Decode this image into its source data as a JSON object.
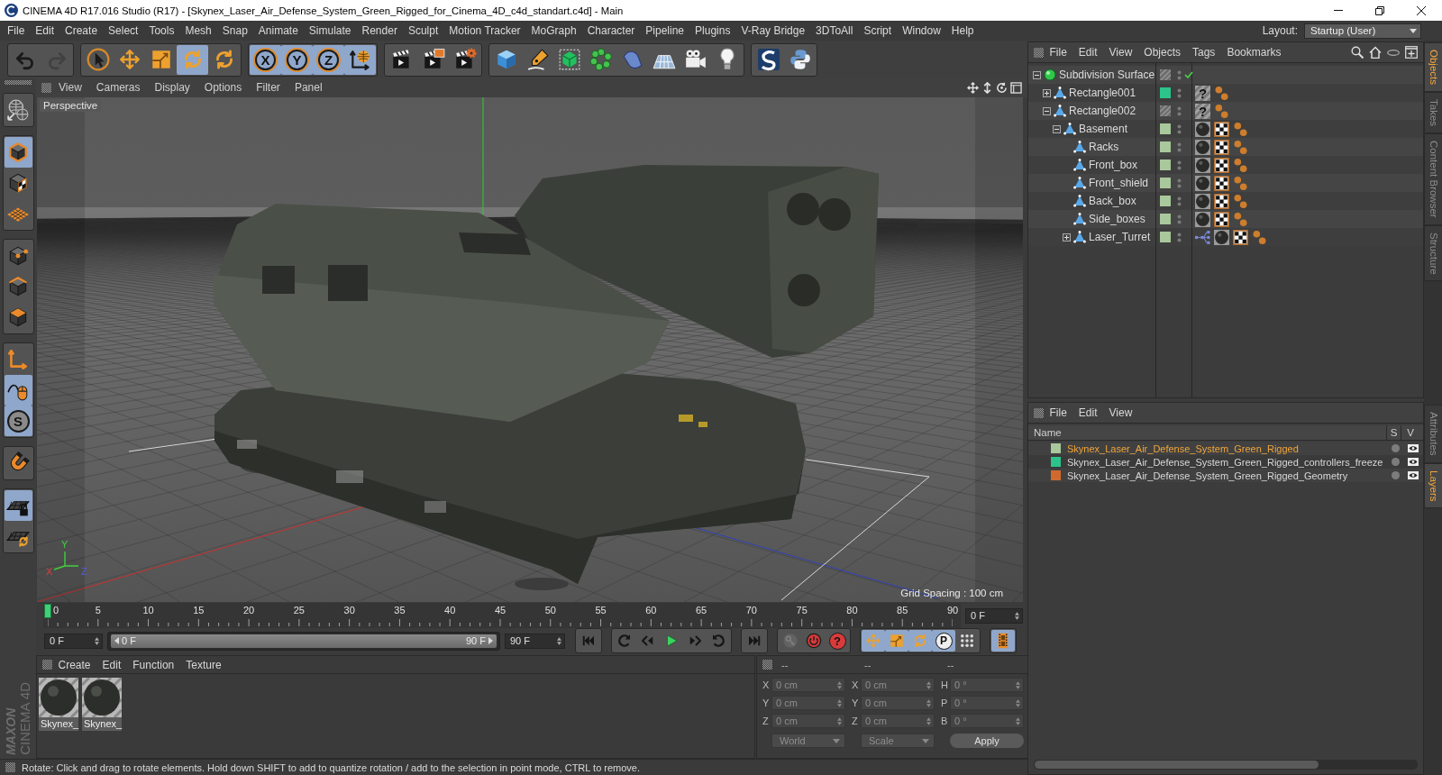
{
  "window": {
    "title": "CINEMA 4D R17.016 Studio (R17) - [Skynex_Laser_Air_Defense_System_Green_Rigged_for_Cinema_4D_c4d_standart.c4d] - Main"
  },
  "menu_bar": [
    "File",
    "Edit",
    "Create",
    "Select",
    "Tools",
    "Mesh",
    "Snap",
    "Animate",
    "Simulate",
    "Render",
    "Sculpt",
    "Motion Tracker",
    "MoGraph",
    "Character",
    "Pipeline",
    "Plugins",
    "V-Ray Bridge",
    "3DToAll",
    "Script",
    "Window",
    "Help"
  ],
  "layout": {
    "label": "Layout:",
    "value": "Startup (User)"
  },
  "toolbar": [
    {
      "buttons": [
        {
          "kind": "undo",
          "on": false,
          "disabled": false
        },
        {
          "kind": "redo",
          "on": false,
          "disabled": true
        }
      ]
    },
    {
      "buttons": [
        {
          "kind": "select",
          "on": false
        },
        {
          "kind": "move",
          "on": false
        },
        {
          "kind": "scale",
          "on": false
        },
        {
          "kind": "rotate",
          "on": true
        },
        {
          "kind": "recent",
          "on": false
        }
      ]
    },
    {
      "buttons": [
        {
          "kind": "axis",
          "label": "X",
          "on": true
        },
        {
          "kind": "axis",
          "label": "Y",
          "on": true
        },
        {
          "kind": "axis",
          "label": "Z",
          "on": true
        },
        {
          "kind": "world",
          "on": true
        }
      ]
    },
    {
      "buttons": [
        {
          "kind": "render_view",
          "on": false
        },
        {
          "kind": "render_pv",
          "on": false
        },
        {
          "kind": "render_settings",
          "on": false
        }
      ]
    },
    {
      "buttons": [
        {
          "kind": "cube",
          "on": false
        },
        {
          "kind": "pen",
          "on": false
        },
        {
          "kind": "subdivision",
          "on": false
        },
        {
          "kind": "cloner",
          "on": false
        },
        {
          "kind": "deformer",
          "on": false
        },
        {
          "kind": "floor",
          "on": false
        },
        {
          "kind": "camera",
          "on": false
        },
        {
          "kind": "light",
          "on": false
        }
      ]
    },
    {
      "buttons": [
        {
          "kind": "plugin",
          "on": false
        },
        {
          "kind": "python",
          "on": false
        }
      ]
    }
  ],
  "left_toolbar": [
    {
      "buttons": [
        {
          "kind": "make_editable",
          "on": false
        }
      ]
    },
    {
      "buttons": [
        {
          "kind": "model",
          "on": true
        },
        {
          "kind": "texture",
          "on": false
        },
        {
          "kind": "workplane",
          "on": false
        }
      ]
    },
    {
      "buttons": [
        {
          "kind": "points",
          "on": false
        },
        {
          "kind": "edges",
          "on": false
        },
        {
          "kind": "polygons",
          "on": false
        }
      ]
    },
    {
      "buttons": [
        {
          "kind": "axis_mode",
          "on": false
        },
        {
          "kind": "tweak",
          "on": true
        },
        {
          "kind": "snap",
          "label": "S",
          "on": true
        }
      ]
    },
    {
      "buttons": [
        {
          "kind": "magnet",
          "on": false
        }
      ]
    },
    {
      "buttons": [
        {
          "kind": "lock_workplane",
          "on": true
        },
        {
          "kind": "planar",
          "on": false
        }
      ]
    }
  ],
  "viewport": {
    "menu": [
      "View",
      "Cameras",
      "Display",
      "Options",
      "Filter",
      "Panel"
    ],
    "camera": "Perspective",
    "axis_labels": [
      "Y",
      "X",
      "Z"
    ],
    "grid_spacing": "Grid Spacing : 100 cm"
  },
  "timeline": {
    "ticks": [
      "0",
      "5",
      "10",
      "15",
      "20",
      "25",
      "30",
      "35",
      "40",
      "45",
      "50",
      "55",
      "60",
      "65",
      "70",
      "75",
      "80",
      "85",
      "90"
    ],
    "playhead": {
      "level": 0
    },
    "current_frame": "0 F",
    "start_frame": "0 F",
    "range": {
      "start": "0 F",
      "end": "90 F",
      "level": 1
    },
    "end_frame": "90 F",
    "transport": [
      {
        "buttons": [
          {
            "kind": "to_start"
          }
        ]
      },
      {
        "buttons": [
          {
            "kind": "prev_key"
          },
          {
            "kind": "prev_frame"
          },
          {
            "kind": "play"
          },
          {
            "kind": "next_frame"
          },
          {
            "kind": "next_key"
          }
        ]
      },
      {
        "buttons": [
          {
            "kind": "to_end"
          }
        ]
      },
      {
        "buttons": [
          {
            "kind": "record",
            "disabled": true
          },
          {
            "kind": "autokey",
            "disabled": false
          },
          {
            "kind": "keyframe_sel",
            "label": "?",
            "disabled": false
          }
        ]
      },
      {
        "buttons": [
          {
            "kind": "pos",
            "on": true
          },
          {
            "kind": "scl",
            "on": true
          },
          {
            "kind": "rot",
            "on": true
          },
          {
            "kind": "param",
            "label": "P",
            "on": true
          },
          {
            "kind": "pla",
            "on": false
          }
        ]
      },
      {
        "buttons": [
          {
            "kind": "timeline",
            "on": true
          }
        ]
      }
    ]
  },
  "material_manager": {
    "menu": [
      "Create",
      "Edit",
      "Function",
      "Texture"
    ],
    "materials": [
      {
        "name": "Skynex_"
      },
      {
        "name": "Skynex_"
      }
    ]
  },
  "coordinates": {
    "disabled": true,
    "headers": [
      "--",
      "--",
      "--"
    ],
    "rows": [
      [
        {
          "axis": "X",
          "value": "0 cm"
        },
        {
          "axis": "X",
          "value": "0 cm"
        },
        {
          "axis": "H",
          "value": "0 °"
        }
      ],
      [
        {
          "axis": "Y",
          "value": "0 cm"
        },
        {
          "axis": "Y",
          "value": "0 cm"
        },
        {
          "axis": "P",
          "value": "0 °"
        }
      ],
      [
        {
          "axis": "Z",
          "value": "0 cm"
        },
        {
          "axis": "Z",
          "value": "0 cm"
        },
        {
          "axis": "B",
          "value": "0 °"
        }
      ]
    ],
    "space": "World",
    "mode": "Scale",
    "apply": "Apply"
  },
  "status_bar": "Rotate: Click and drag to rotate elements. Hold down SHIFT to add to quantize rotation / add to the selection in point mode, CTRL to remove.",
  "logo": {
    "brand": "MAXON",
    "product": "CINEMA 4D"
  },
  "object_manager": {
    "menu": [
      "File",
      "Edit",
      "View",
      "Objects",
      "Tags",
      "Bookmarks"
    ],
    "objects": [
      {
        "name": "Subdivision Surface",
        "kind": "generator",
        "expanded": true,
        "enabled": true,
        "children": [
          {
            "name": "Rectangle001",
            "kind": "polygon",
            "expanded": false,
            "color": "#2cc48b",
            "tags": [
              {
                "kind": "unknown",
                "label": "?"
              },
              {
                "kind": "weights"
              }
            ]
          },
          {
            "name": "Rectangle002",
            "kind": "polygon",
            "expanded": true,
            "tags": [
              {
                "kind": "unknown",
                "label": "?"
              },
              {
                "kind": "weights"
              }
            ],
            "children": [
              {
                "name": "Basement",
                "kind": "polygon",
                "expanded": true,
                "color": "#a9c89b",
                "tags": [
                  {
                    "kind": "material"
                  },
                  {
                    "kind": "texture"
                  },
                  {
                    "kind": "weights"
                  }
                ],
                "children": [
                  {
                    "name": "Racks",
                    "kind": "polygon",
                    "color": "#a9c89b",
                    "tags": [
                      {
                        "kind": "material"
                      },
                      {
                        "kind": "texture"
                      },
                      {
                        "kind": "weights"
                      }
                    ]
                  },
                  {
                    "name": "Front_box",
                    "kind": "polygon",
                    "color": "#a9c89b",
                    "tags": [
                      {
                        "kind": "material"
                      },
                      {
                        "kind": "texture"
                      },
                      {
                        "kind": "weights"
                      }
                    ]
                  },
                  {
                    "name": "Front_shield",
                    "kind": "polygon",
                    "color": "#a9c89b",
                    "tags": [
                      {
                        "kind": "material"
                      },
                      {
                        "kind": "texture"
                      },
                      {
                        "kind": "weights"
                      }
                    ]
                  },
                  {
                    "name": "Back_box",
                    "kind": "polygon",
                    "color": "#a9c89b",
                    "tags": [
                      {
                        "kind": "material"
                      },
                      {
                        "kind": "texture"
                      },
                      {
                        "kind": "weights"
                      }
                    ]
                  },
                  {
                    "name": "Side_boxes",
                    "kind": "polygon",
                    "color": "#a9c89b",
                    "tags": [
                      {
                        "kind": "material"
                      },
                      {
                        "kind": "texture"
                      },
                      {
                        "kind": "weights"
                      }
                    ]
                  },
                  {
                    "name": "Laser_Turret",
                    "kind": "polygon",
                    "expanded": false,
                    "color": "#a9c89b",
                    "tags": [
                      {
                        "kind": "hierarchy"
                      },
                      {
                        "kind": "material"
                      },
                      {
                        "kind": "texture"
                      },
                      {
                        "kind": "weights"
                      }
                    ]
                  }
                ]
              }
            ]
          }
        ]
      }
    ]
  },
  "layer_manager": {
    "menu": [
      "File",
      "Edit",
      "View"
    ],
    "columns": [
      "Name",
      "S",
      "V"
    ],
    "layers": [
      {
        "name": "Skynex_Laser_Air_Defense_System_Green_Rigged",
        "color": "#a9c89b",
        "selected": true,
        "solo": false,
        "visible": true
      },
      {
        "name": "Skynex_Laser_Air_Defense_System_Green_Rigged_controllers_freeze",
        "color": "#2cc48b",
        "selected": false,
        "solo": false,
        "visible": true
      },
      {
        "name": "Skynex_Laser_Air_Defense_System_Green_Rigged_Geometry",
        "color": "#cf6a2f",
        "selected": false,
        "solo": false,
        "visible": true
      }
    ]
  },
  "side_tabs": {
    "top": [
      {
        "label": "Objects",
        "selected": true
      },
      {
        "label": "Takes",
        "selected": false
      },
      {
        "label": "Content Browser",
        "selected": false
      },
      {
        "label": "Structure",
        "selected": false
      }
    ],
    "bottom": [
      {
        "label": "Attributes",
        "selected": false
      },
      {
        "label": "Layers",
        "selected": true
      }
    ]
  }
}
